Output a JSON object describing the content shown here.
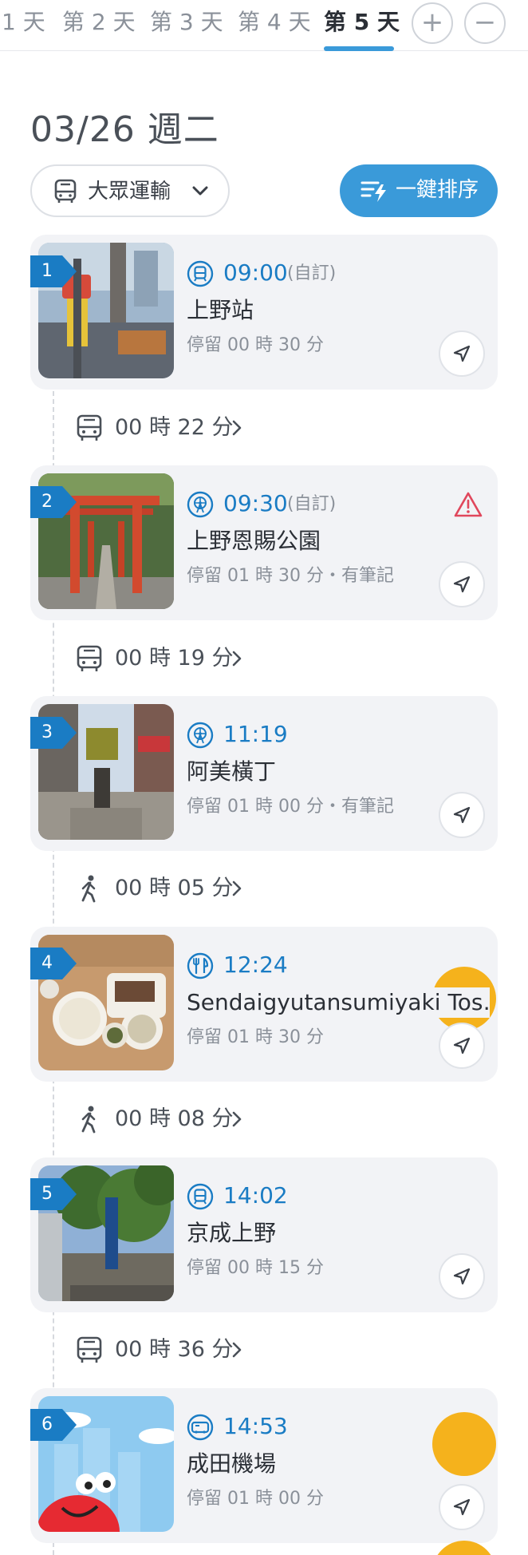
{
  "tabs": {
    "items": [
      {
        "label": "1 天"
      },
      {
        "label": "第 2 天"
      },
      {
        "label": "第 3 天"
      },
      {
        "label": "第 4 天"
      },
      {
        "label": "第 5 天"
      }
    ],
    "active_index": 4,
    "add_icon": "plus-icon",
    "remove_icon": "minus-icon"
  },
  "header": {
    "date": "03/26 週二",
    "transport_mode": "大眾運輸",
    "sort_button": "一鍵排序"
  },
  "colors": {
    "accent": "#3a9ad9",
    "time_text": "#1a7cc4",
    "warning": "#e0475c",
    "marker": "#f5b21c"
  },
  "stops": [
    {
      "index": "1",
      "time": "09:00",
      "custom": "(自訂)",
      "name": "上野站",
      "stay": "停留 00 時 30 分",
      "category_icon": "train-icon"
    },
    {
      "index": "2",
      "time": "09:30",
      "custom": "(自訂)",
      "name": "上野恩賜公園",
      "stay": "停留 01 時 30 分・有筆記",
      "category_icon": "ferris-wheel-icon",
      "warning_icon": "warning-triangle-icon"
    },
    {
      "index": "3",
      "time": "11:19",
      "name": "阿美橫丁",
      "stay": "停留 01 時 00 分・有筆記",
      "category_icon": "ferris-wheel-icon"
    },
    {
      "index": "4",
      "time": "12:24",
      "name": "Sendaigyutansumiyaki Tos…",
      "stay": "停留 01 時 30 分",
      "category_icon": "utensils-icon"
    },
    {
      "index": "5",
      "time": "14:02",
      "name": "京成上野",
      "stay": "停留 00 時 15 分",
      "category_icon": "train-icon"
    },
    {
      "index": "6",
      "time": "14:53",
      "name": "成田機場",
      "stay": "停留 01 時 00 分",
      "category_icon": "airport-bus-icon"
    }
  ],
  "transits": [
    {
      "mode": "bus-icon",
      "duration": "00 時 22 分"
    },
    {
      "mode": "bus-icon",
      "duration": "00 時 19 分"
    },
    {
      "mode": "walk-icon",
      "duration": "00 時 05 分"
    },
    {
      "mode": "walk-icon",
      "duration": "00 時 08 分"
    },
    {
      "mode": "bus-icon",
      "duration": "00 時 36 分"
    }
  ]
}
